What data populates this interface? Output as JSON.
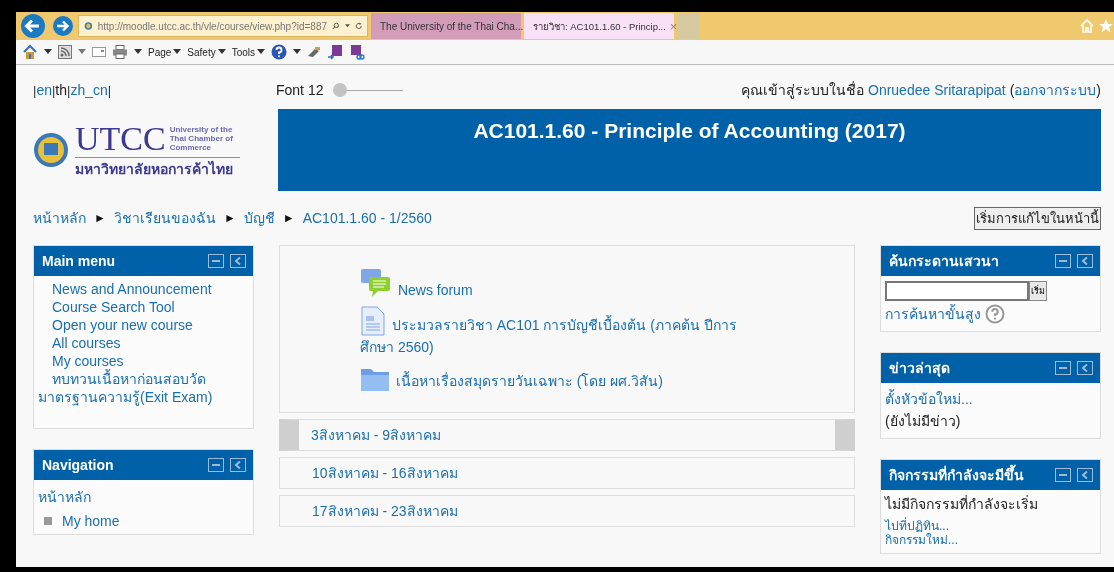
{
  "browser": {
    "address": "http://moodle.utcc.ac.th/vle/course/view.php?id=887",
    "tabs": [
      {
        "label": "The University of the Thai Cha...",
        "selected": false
      },
      {
        "label": "รายวิชา: AC101.1.60 - Princip...",
        "selected": true
      }
    ],
    "tab_close": "×",
    "commands": [
      "Page",
      "Safety",
      "Tools"
    ]
  },
  "language_separator": "|",
  "languages": [
    {
      "label": "en",
      "selected": false
    },
    {
      "label": "th",
      "selected": true
    },
    {
      "label": "zh_cn",
      "selected": false
    }
  ],
  "font_size": {
    "label": "Font 12",
    "level": 0
  },
  "login": {
    "prefix": "คุณเข้าสู่ระบบในชื่อ",
    "user": "Onruedee Sritarapipat",
    "logout": "ออกจากระบบ",
    "brackets": [
      "(",
      ")"
    ]
  },
  "logo": {
    "name": "UTCC",
    "subtitle": "University of the Thai Chamber of Commerce",
    "thai_name": "มหาวิทยาลัยหอการค้าไทย"
  },
  "course_title": "AC101.1.60 - Principle of Accounting (2017)",
  "breadcrumb": [
    "หน้าหลัก",
    "วิชาเรียนของฉัน",
    "บัญชี",
    "AC101.1.60 - 1/2560"
  ],
  "breadcrumb_separator": "►",
  "edit_button": "เริ่มการแก้ไขในหน้านี้",
  "main_menu": {
    "title": "Main menu",
    "items": [
      "News and Announcement",
      "Course Search Tool",
      "Open your new course",
      "All courses",
      "My courses",
      "ทบทวนเนื้อหาก่อนสอบวัดมาตรฐานความรู้(Exit Exam)"
    ]
  },
  "navigation": {
    "title": "Navigation",
    "home": "หน้าหลัก",
    "items": [
      "My home"
    ]
  },
  "resources": [
    {
      "kind": "forum",
      "label": "News forum"
    },
    {
      "kind": "file",
      "label": "ประมวลรายวิชา AC101 การบัญชีเบื้องต้น (ภาคต้น ปีการศึกษา 2560)"
    },
    {
      "kind": "folder",
      "label": "เนื้อหาเรื่องสมุดรายวันเฉพาะ (โดย ผศ.วิสัน)"
    }
  ],
  "weeks": [
    {
      "label": "3สิงหาคม - 9สิงหาคม",
      "selected": true
    },
    {
      "label": "10สิงหาคม - 16สิงหาคม",
      "selected": false
    },
    {
      "label": "17สิงหาคม - 23สิงหาคม",
      "selected": false
    }
  ],
  "forum_search": {
    "title": "ค้นกระดานเสวนา",
    "button": "เริ่ม",
    "advanced": "การค้นหาขั้นสูง"
  },
  "latest_news": {
    "title": "ข่าวล่าสุด",
    "link": "ตั้งหัวข้อใหม่...",
    "empty": "(ยังไม่มีข่าว)"
  },
  "upcoming": {
    "title": "กิจกรรมที่กำลังจะมีขึ้น",
    "empty": "ไม่มีกิจกรรมที่กำลังจะเริ่ม",
    "links": [
      "ไปที่ปฏิทิน...",
      "กิจกรรมใหม่..."
    ]
  }
}
